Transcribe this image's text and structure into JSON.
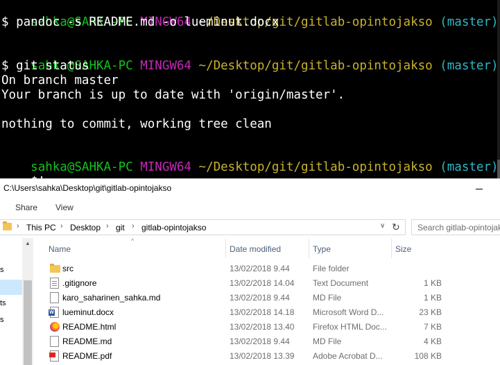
{
  "terminal": {
    "blocks": [
      {
        "user": "sahka@SAHKA-PC",
        "system": "MINGW64",
        "path": "~/Desktop/git/gitlab-opintojakso",
        "branch": "(master)",
        "command": "$ pandoc -s README.md -o lueminut.docx"
      },
      {
        "user": "sahka@SAHKA-PC",
        "system": "MINGW64",
        "path": "~/Desktop/git/gitlab-opintojakso",
        "branch": "(master)",
        "command": "$ git status"
      },
      {
        "user": "sahka@SAHKA-PC",
        "system": "MINGW64",
        "path": "~/Desktop/git/gitlab-opintojakso",
        "branch": "(master)",
        "command": "$"
      }
    ],
    "output": [
      "On branch master",
      "Your branch is up to date with 'origin/master'.",
      "nothing to commit, working tree clean"
    ]
  },
  "explorer": {
    "title": "C:\\Users\\sahka\\Desktop\\git\\gitlab-opintojakso",
    "ribbon_tabs": [
      "Share",
      "View"
    ],
    "breadcrumbs": [
      "This PC",
      "Desktop",
      "git",
      "gitlab-opintojakso"
    ],
    "search_placeholder": "Search gitlab-opintojakso",
    "nav_fragments": [
      "s",
      "ts",
      "s"
    ],
    "columns": [
      "Name",
      "Date modified",
      "Type",
      "Size"
    ],
    "files": [
      {
        "name": "src",
        "date": "13/02/2018 9.44",
        "type": "File folder",
        "size": "",
        "icon": "folder-icon"
      },
      {
        "name": ".gitignore",
        "date": "13/02/2018 14.04",
        "type": "Text Document",
        "size": "1 KB",
        "icon": "text-document-icon"
      },
      {
        "name": "karo_saharinen_sahka.md",
        "date": "13/02/2018 9.44",
        "type": "MD File",
        "size": "1 KB",
        "icon": "file-icon"
      },
      {
        "name": "lueminut.docx",
        "date": "13/02/2018 14.18",
        "type": "Microsoft Word D...",
        "size": "23 KB",
        "icon": "word-document-icon"
      },
      {
        "name": "README.html",
        "date": "13/02/2018 13.40",
        "type": "Firefox HTML Doc...",
        "size": "7 KB",
        "icon": "firefox-html-icon"
      },
      {
        "name": "README.md",
        "date": "13/02/2018 9.44",
        "type": "MD File",
        "size": "4 KB",
        "icon": "file-icon"
      },
      {
        "name": "README.pdf",
        "date": "13/02/2018 13.39",
        "type": "Adobe Acrobat D...",
        "size": "108 KB",
        "icon": "pdf-icon"
      }
    ],
    "colors": {
      "selection": "#cce8ff",
      "header_text": "#4c607a",
      "terminal_user": "#13c21e",
      "terminal_system": "#c528b8",
      "terminal_path": "#c8b32d",
      "terminal_branch": "#2cb8c6"
    }
  }
}
